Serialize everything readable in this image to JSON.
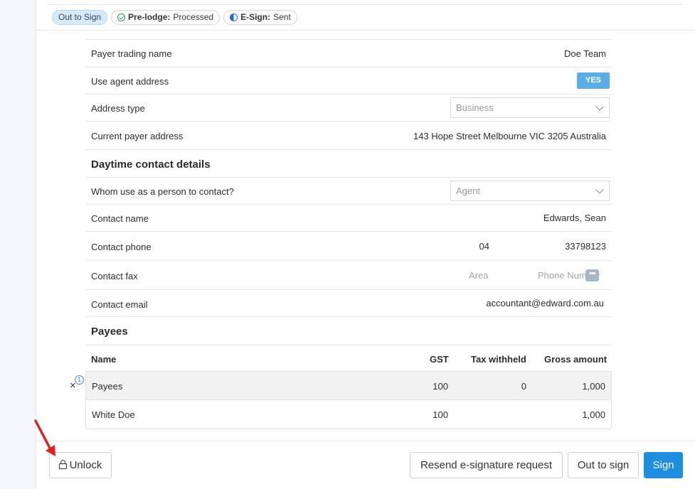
{
  "status_badges": [
    {
      "label": "Out to Sign",
      "bold": "",
      "text": ""
    },
    {
      "label": "",
      "bold": "Pre-lodge:",
      "text": "Processed"
    },
    {
      "label": "",
      "bold": "E-Sign:",
      "text": "Sent"
    }
  ],
  "payer": {
    "trading_name_label": "Payer trading name",
    "trading_name_value": "Doe Team",
    "use_agent_address_label": "Use agent address",
    "use_agent_address_value": "YES",
    "address_type_label": "Address type",
    "address_type_value": "Business",
    "current_address_label": "Current payer address",
    "current_address_value": "143 Hope Street Melbourne VIC 3205 Australia"
  },
  "contact": {
    "section_title": "Daytime contact details",
    "whom_label": "Whom use as a person to contact?",
    "whom_value": "Agent",
    "name_label": "Contact name",
    "name_value": "Edwards, Sean",
    "phone_label": "Contact phone",
    "phone_area": "04",
    "phone_number": "33798123",
    "fax_label": "Contact fax",
    "fax_area_placeholder": "Area",
    "fax_number_placeholder": "Phone Number",
    "email_label": "Contact email",
    "email_value": "accountant@edward.com.au"
  },
  "payees": {
    "section_title": "Payees",
    "headers": {
      "name": "Name",
      "gst": "GST",
      "tax": "Tax withheld",
      "gross": "Gross amount"
    },
    "rows": [
      {
        "name": "Payees",
        "gst": "100",
        "tax": "0",
        "gross": "1,000"
      },
      {
        "name": "White Doe",
        "gst": "100",
        "tax": "",
        "gross": "1,000"
      }
    ],
    "count_badge": "1"
  },
  "footer": {
    "unlock_label": "Unlock",
    "resend_label": "Resend e-signature request",
    "out_to_sign_label": "Out to sign",
    "sign_label": "Sign"
  },
  "colors": {
    "primary": "#1e8fe0",
    "toggle": "#5aaee6",
    "annotation_arrow": "#e02020"
  }
}
